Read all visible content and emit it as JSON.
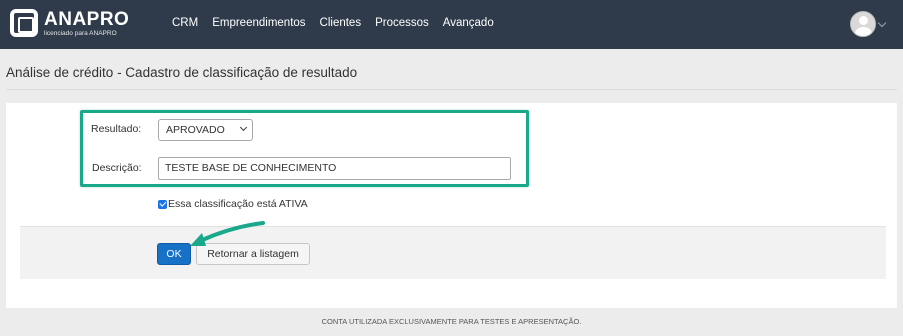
{
  "navbar": {
    "brand_name": "ANAPRO",
    "brand_sub": "licenciado para ANAPRO",
    "menu": [
      "CRM",
      "Empreendimentos",
      "Clientes",
      "Processos",
      "Avançado"
    ],
    "user_icon": "user-avatar-icon"
  },
  "page": {
    "title": "Análise de crédito - Cadastro de classificação de resultado"
  },
  "form": {
    "resultado_label": "Resultado:",
    "resultado_value": "APROVADO",
    "descricao_label": "Descrição:",
    "descricao_value": "TESTE BASE DE CONHECIMENTO",
    "ativa_checked": true,
    "ativa_label": "Essa classificação está ATIVA"
  },
  "actions": {
    "ok_label": "OK",
    "back_label": "Retornar a listagem"
  },
  "annotation": {
    "color": "#1aa88a"
  },
  "footer": {
    "text": "CONTA UTILIZADA EXCLUSIVAMENTE PARA TESTES E APRESENTAÇÃO."
  }
}
